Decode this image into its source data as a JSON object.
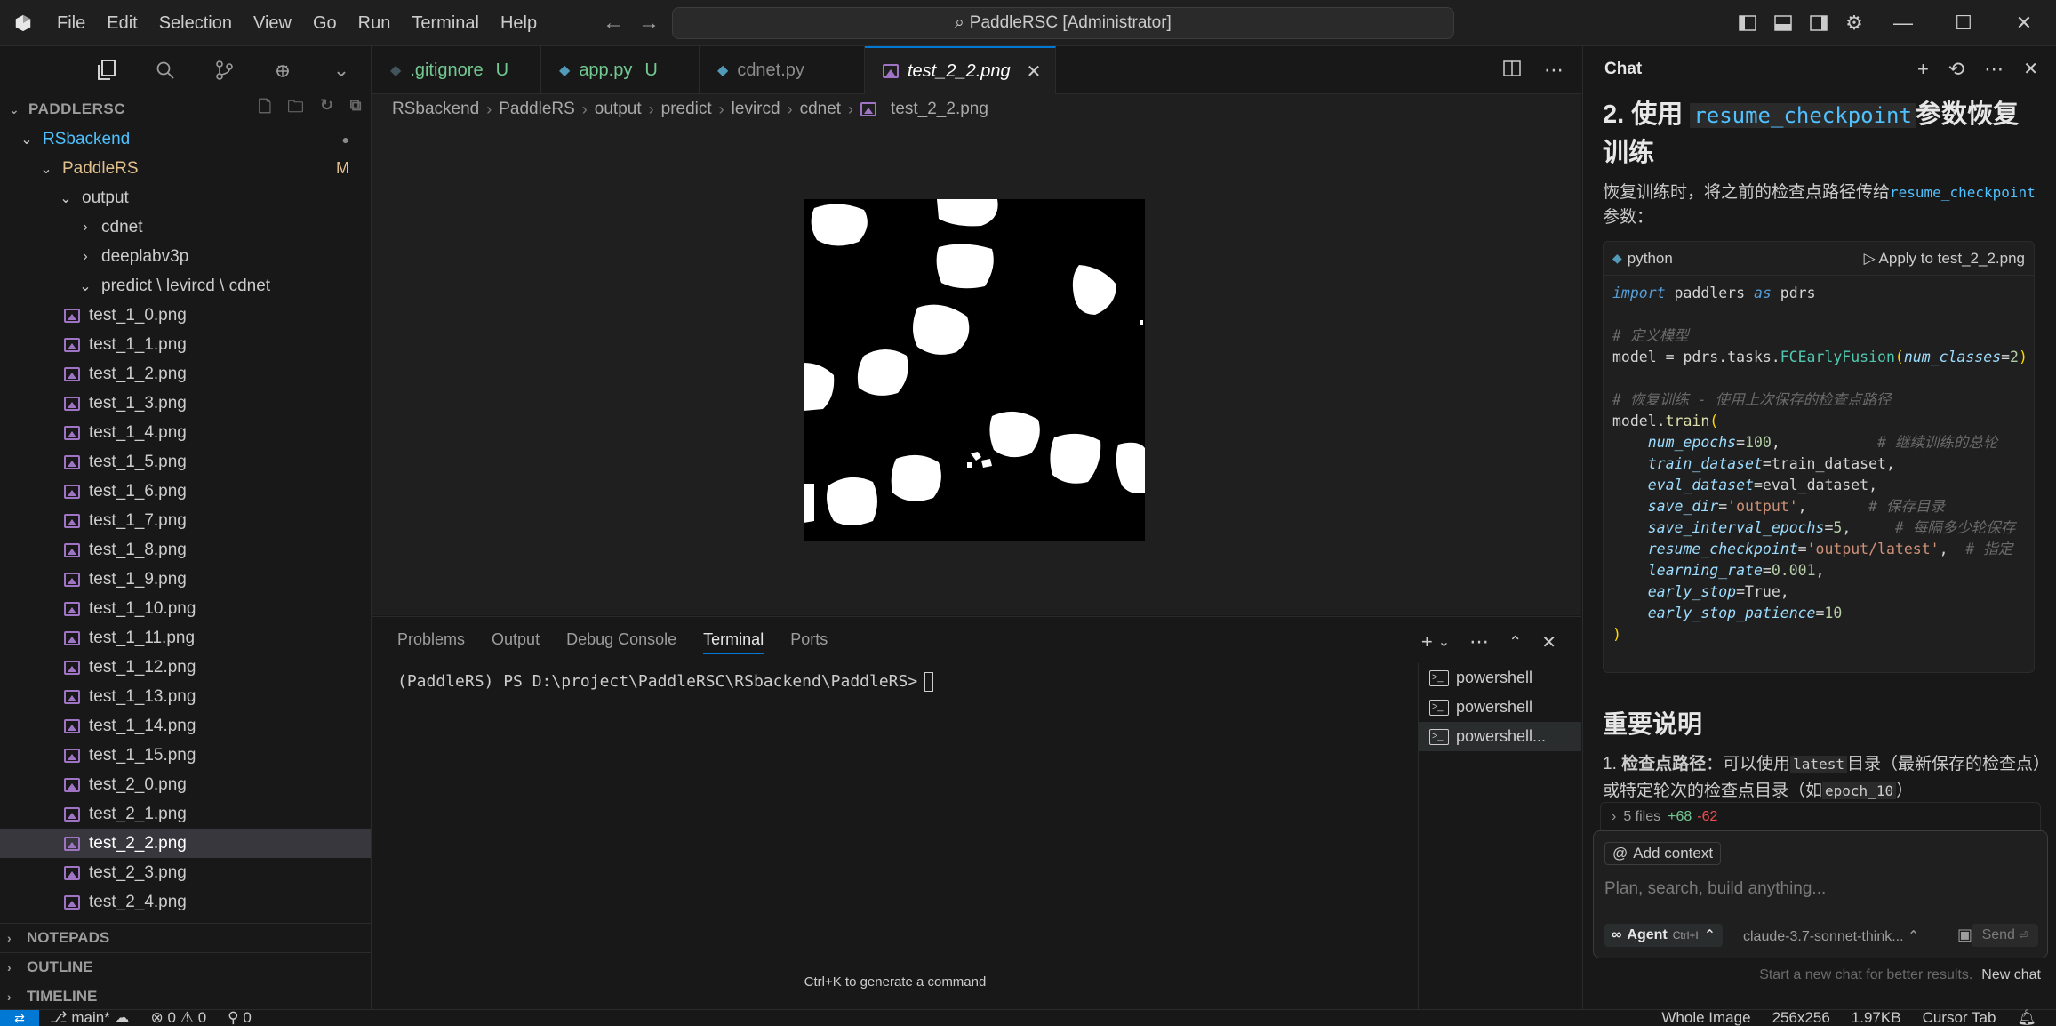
{
  "titlebar": {
    "menu": [
      "File",
      "Edit",
      "Selection",
      "View",
      "Go",
      "Run",
      "Terminal",
      "Help"
    ],
    "search_text": "PaddleRSC [Administrator]"
  },
  "explorer": {
    "root": "PADDLERSC",
    "tree": [
      {
        "label": "RSbackend",
        "depth": 0,
        "chev": "open",
        "color": "#4fc1ff",
        "badge": "●",
        "badge_color": "#8b8b8b"
      },
      {
        "label": "PaddleRS",
        "depth": 1,
        "chev": "open",
        "color": "#e2c08d",
        "badge": "M",
        "badge_color": "#e2c08d"
      },
      {
        "label": "output",
        "depth": 2,
        "chev": "open",
        "color": "#cccccc"
      },
      {
        "label": "cdnet",
        "depth": 3,
        "chev": "closed",
        "color": "#cccccc"
      },
      {
        "label": "deeplabv3p",
        "depth": 3,
        "chev": "closed",
        "color": "#cccccc"
      },
      {
        "label": "predict \\ levircd \\ cdnet",
        "depth": 3,
        "chev": "open",
        "color": "#cccccc"
      }
    ],
    "files": [
      "test_1_0.png",
      "test_1_1.png",
      "test_1_2.png",
      "test_1_3.png",
      "test_1_4.png",
      "test_1_5.png",
      "test_1_6.png",
      "test_1_7.png",
      "test_1_8.png",
      "test_1_9.png",
      "test_1_10.png",
      "test_1_11.png",
      "test_1_12.png",
      "test_1_13.png",
      "test_1_14.png",
      "test_1_15.png",
      "test_2_0.png",
      "test_2_1.png",
      "test_2_2.png",
      "test_2_3.png",
      "test_2_4.png"
    ],
    "selected_file": "test_2_2.png",
    "sections": [
      "NOTEPADS",
      "OUTLINE",
      "TIMELINE"
    ]
  },
  "editor": {
    "tabs": [
      {
        "label": ".gitignore",
        "badge": "U",
        "kind": "git"
      },
      {
        "label": "app.py",
        "badge": "U",
        "kind": "py"
      },
      {
        "label": "cdnet.py",
        "badge": "",
        "kind": "py"
      },
      {
        "label": "test_2_2.png",
        "badge": "",
        "kind": "img",
        "active": true
      }
    ],
    "breadcrumb": [
      "RSbackend",
      "PaddleRS",
      "output",
      "predict",
      "levircd",
      "cdnet",
      "test_2_2.png"
    ]
  },
  "panel": {
    "tabs": [
      "Problems",
      "Output",
      "Debug Console",
      "Terminal",
      "Ports"
    ],
    "active_tab": "Terminal",
    "prompt": "(PaddleRS) PS D:\\project\\PaddleRSC\\RSbackend\\PaddleRS>",
    "terminals": [
      "powershell",
      "powershell",
      "powershell..."
    ],
    "hint": "Ctrl+K to generate a command"
  },
  "chat": {
    "title": "Chat",
    "heading_prefix": "2. 使用",
    "heading_code": "resume_checkpoint",
    "heading_suffix": "参数恢复训练",
    "intro_text": "恢复训练时，将之前的检查点路径传给",
    "intro_code": "resume_checkpoint",
    "intro_end": "参数：",
    "code_lang": "python",
    "apply_label": "Apply to test_2_2.png",
    "section_title": "重要说明",
    "list_item_bold": "检查点路径",
    "list_item_text": "：可以使用",
    "list_item_code1": "latest",
    "list_item_text2": "目录（最新保存的检查点）或特定轮次的检查点目录（如",
    "list_item_code2": "epoch_10",
    "list_item_text3": "）",
    "files_changed": "5 files",
    "files_added": "+68",
    "files_removed": "-62",
    "add_context": "Add context",
    "placeholder": "Plan, search, build anything...",
    "agent_label": "Agent",
    "agent_shortcut": "Ctrl+I",
    "model": "claude-3.7-sonnet-think...",
    "send": "Send",
    "new_chat_hint": "Start a new chat for better results.",
    "new_chat": "New chat"
  },
  "statusbar": {
    "branch": "main*",
    "errors": "0",
    "warnings": "0",
    "ports": "0",
    "right": [
      "Whole Image",
      "256x256",
      "1.97KB",
      "Cursor Tab"
    ]
  },
  "colors": {
    "accent": "#0078d4",
    "modified": "#e2c08d",
    "untracked": "#73c991"
  }
}
